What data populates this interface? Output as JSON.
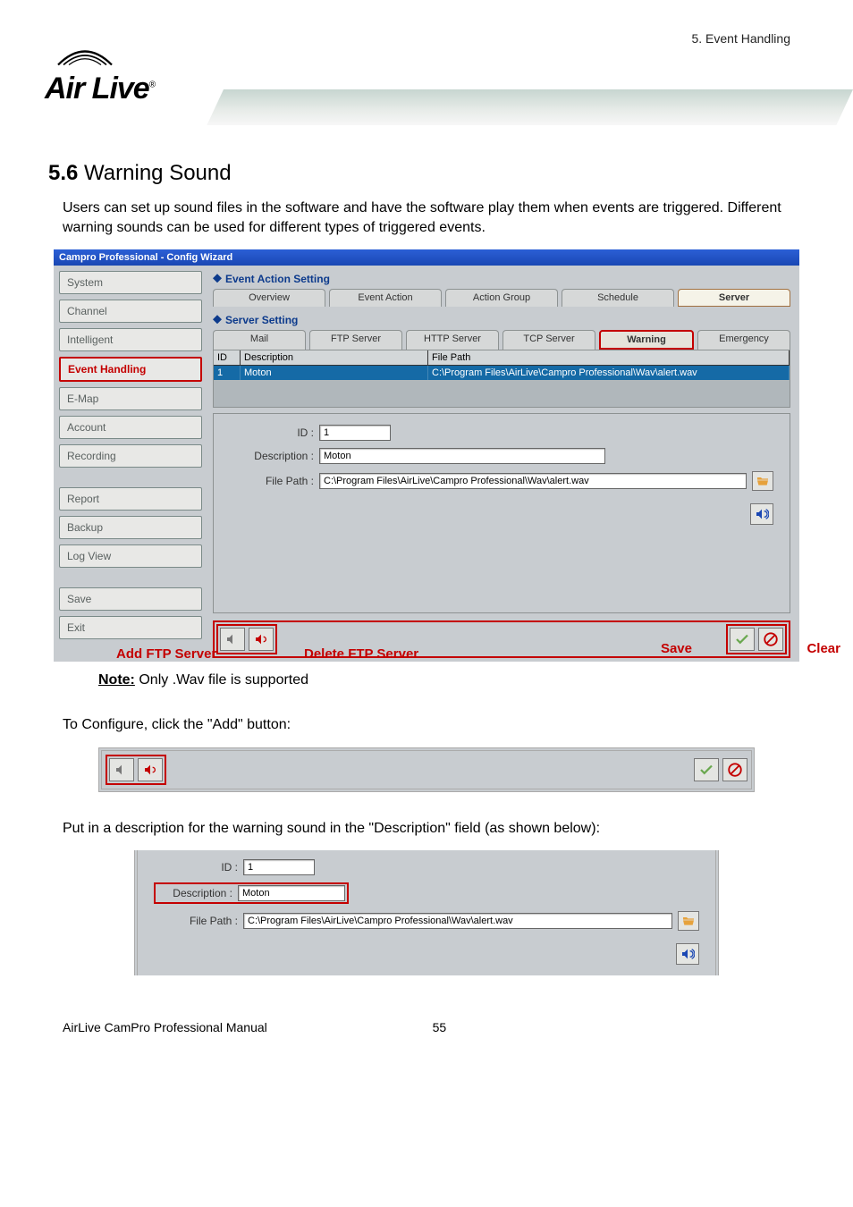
{
  "header": {
    "chapter_ref": "5. Event Handling",
    "logo_text": "Air Live",
    "logo_reg": "®"
  },
  "section": {
    "number": "5.6",
    "title": "Warning Sound",
    "intro": "Users can set up sound files in the software and have the software play them when events are triggered. Different warning sounds can be used for different types of triggered events."
  },
  "window": {
    "title": "Campro Professional - Config Wizard",
    "sidebar": {
      "items": [
        "System",
        "Channel",
        "Intelligent",
        "Event Handling",
        "E-Map",
        "Account",
        "Recording",
        "Report",
        "Backup",
        "Log View",
        "Save",
        "Exit"
      ],
      "active_index": 3
    },
    "panel1_title": "Event Action Setting",
    "top_tabs": {
      "items": [
        "Overview",
        "Event Action",
        "Action Group",
        "Schedule",
        "Server"
      ],
      "active_index": 4
    },
    "panel2_title": "Server Setting",
    "sub_tabs": {
      "items": [
        "Mail",
        "FTP Server",
        "HTTP Server",
        "TCP Server",
        "Warning",
        "Emergency"
      ],
      "outlined_index": 4
    },
    "table": {
      "headers": {
        "id": "ID",
        "desc": "Description",
        "path": "File Path"
      },
      "row": {
        "id": "1",
        "desc": "Moton",
        "path": "C:\\Program Files\\AirLive\\Campro Professional\\Wav\\alert.wav"
      }
    },
    "form": {
      "id_label": "ID :",
      "id_value": "1",
      "desc_label": "Description :",
      "desc_value": "Moton",
      "path_label": "File Path :",
      "path_value": "C:\\Program Files\\AirLive\\Campro Professional\\Wav\\alert.wav"
    }
  },
  "annotations": {
    "add": "Add FTP Server",
    "del": "Delete FTP Server",
    "save": "Save",
    "clear": "Clear"
  },
  "note": {
    "label": "Note:",
    "text": "Only .Wav file is supported"
  },
  "configure_text": "To Configure, click the \"Add\" button:",
  "desc_field_text": "Put in a description for the warning sound in the \"Description\" field (as shown below):",
  "footer": {
    "manual": "AirLive CamPro Professional Manual",
    "page": "55"
  }
}
